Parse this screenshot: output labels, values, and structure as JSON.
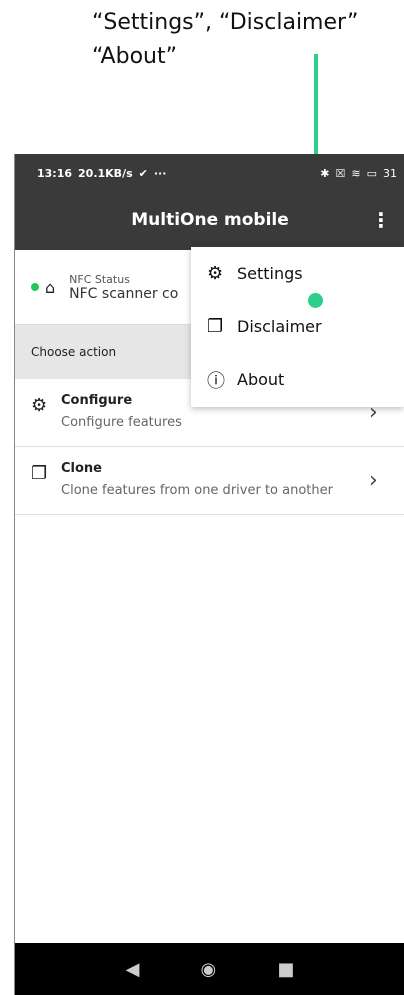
{
  "annotation": {
    "line1": "“Settings”, “Disclaimer”",
    "line2": "“About”"
  },
  "status": {
    "time": "13:16",
    "speed": "20.1KB/s",
    "battery": "31"
  },
  "appbar": {
    "title": "MultiOne mobile"
  },
  "nfc": {
    "label": "NFC Status",
    "value": "NFC scanner co"
  },
  "choose": {
    "label": "Choose action"
  },
  "actions": [
    {
      "title": "Configure",
      "subtitle": "Configure features"
    },
    {
      "title": "Clone",
      "subtitle": "Clone features from one driver to another"
    }
  ],
  "menu": {
    "items": [
      "Settings",
      "Disclaimer",
      "About"
    ]
  },
  "nav": {
    "back": "◀",
    "home": "◉",
    "recent": "■"
  }
}
